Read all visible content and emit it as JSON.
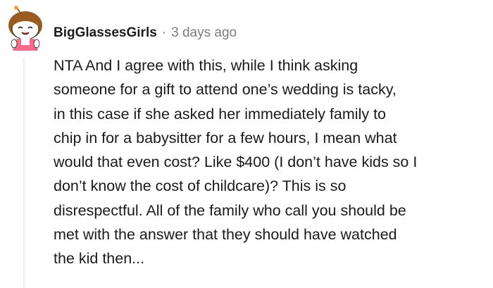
{
  "comment": {
    "author": "BigGlassesGirls",
    "separator": "·",
    "timestamp": "3 days ago",
    "body": "NTA And I agree with this, while I think asking\nsomeone for a gift to attend one’s wedding is tacky,\nin this case if she asked her immediately family to\nchip in for a babysitter for a few hours, I mean what\nwould that even cost? Like $400 (I don’t have kids so I\ndon’t know the cost of childcare)? This is so\ndisrespectful. All of the family who call you should be\nmet with the answer that they should have watched\nthe kid then..."
  },
  "avatar": {
    "icon": "snoo-avatar-icon",
    "hair_color": "#9a5c1e",
    "face_color": "#ffffff",
    "dress_color": "#ff6a8a"
  },
  "colors": {
    "text": "#1a1a1b",
    "muted": "#7c7c7c",
    "thread_line": "#ededed"
  }
}
